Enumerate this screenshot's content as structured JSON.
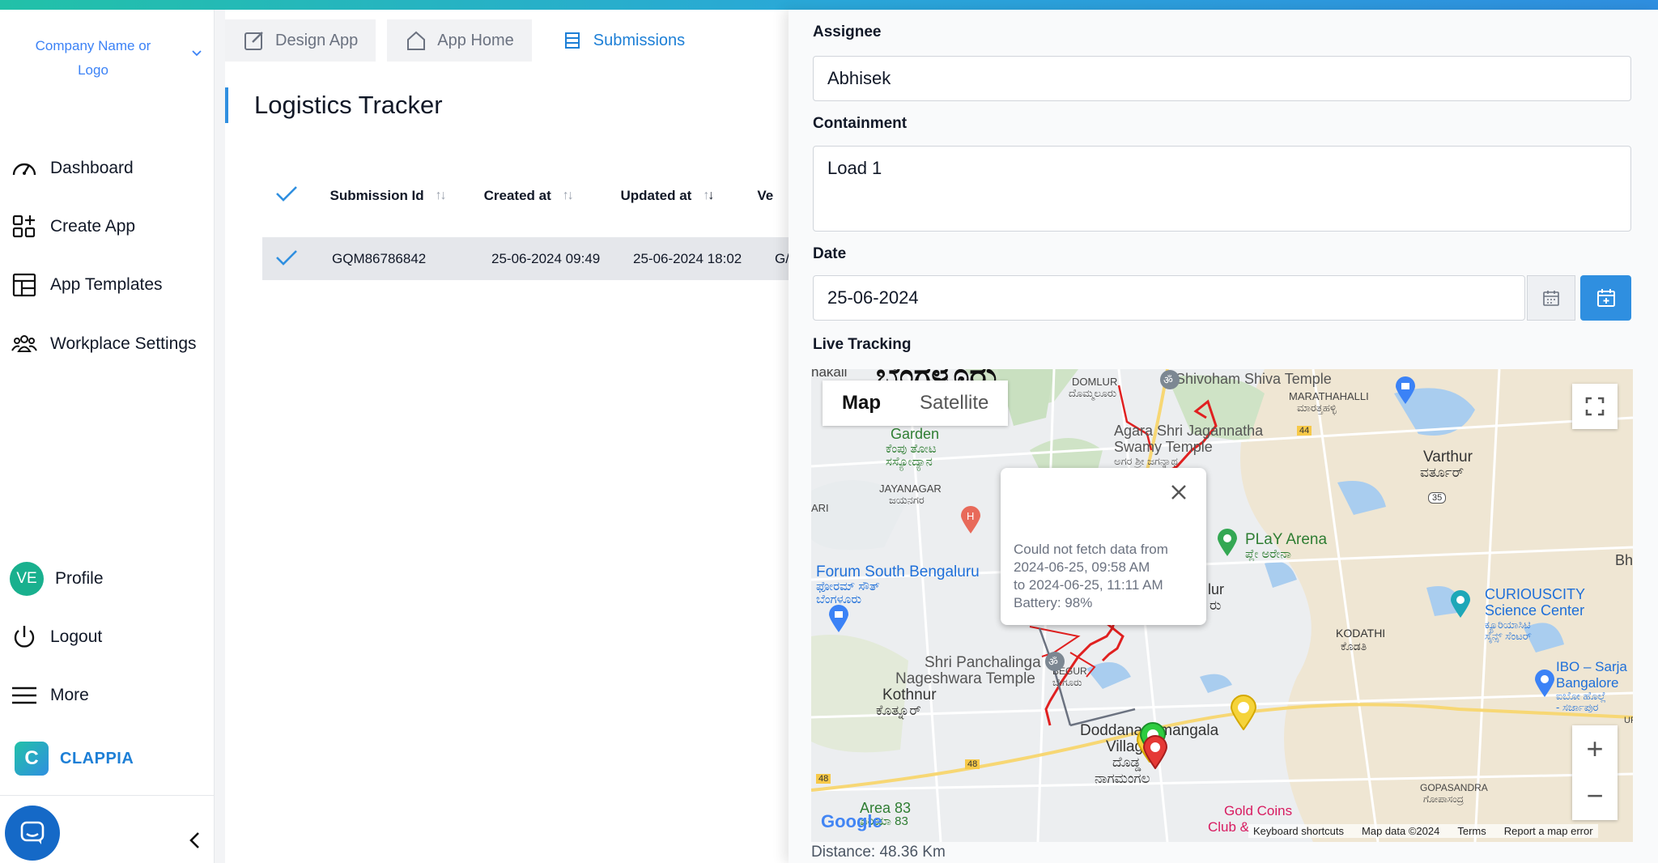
{
  "sidebar": {
    "company": "Company Name or Logo",
    "items": [
      {
        "label": "Dashboard"
      },
      {
        "label": "Create App"
      },
      {
        "label": "App Templates"
      },
      {
        "label": "Workplace Settings"
      }
    ],
    "profile": {
      "initials": "VE",
      "label": "Profile"
    },
    "logout": "Logout",
    "more": "More",
    "brand": "CLAPPIA"
  },
  "tabs": [
    {
      "label": "Design App",
      "active": false
    },
    {
      "label": "App Home",
      "active": false
    },
    {
      "label": "Submissions",
      "active": true
    }
  ],
  "page_title": "Logistics Tracker",
  "table": {
    "columns": [
      "Submission Id",
      "Created at",
      "Updated at",
      "Ve"
    ],
    "rows": [
      {
        "id": "GQM86786842",
        "created": "25-06-2024 09:49",
        "updated": "25-06-2024 18:02",
        "ve": "G/"
      }
    ]
  },
  "panel": {
    "assignee_label": "Assignee",
    "assignee_value": "Abhisek",
    "containment_label": "Containment",
    "containment_value": "Load 1",
    "date_label": "Date",
    "date_value": "25-06-2024",
    "tracking_label": "Live Tracking",
    "distance": "Distance: 48.36 Km"
  },
  "map": {
    "type_map": "Map",
    "type_satellite": "Satellite",
    "popup": {
      "line1": "Could not fetch data from",
      "line2": "2024-06-25, 09:58 AM",
      "line3": "to 2024-06-25, 11:11 AM",
      "line4": "Battery: 98%"
    },
    "footer": {
      "shortcuts": "Keyboard shortcuts",
      "data": "Map data ©2024",
      "terms": "Terms",
      "report": "Report a map error"
    },
    "labels": {
      "domlur": "DOMLUR",
      "domlur_kn": "ದೊಮ್ಮಲೂರು",
      "shivoham": "Shivoham Shiva Temple",
      "marathahalli": "MARATHAHALLI",
      "marathahalli_kn": "ಮಾರತ್ತಹಳ್ಳಿ",
      "garden": "Garden",
      "garden_kn1": "ಕೆಂಪು ತೋಟ",
      "garden_kn2": "ಸಸ್ಯೋದ್ಯಾನ",
      "agara1": "Agara Shri Jagannatha",
      "agara2": "Swamy Temple",
      "agara_kn": "ಅಗರ ಶ್ರೀ ಜಗನ್ನಾಥ",
      "varthur": "Varthur",
      "varthur_kn": "ವರ್ತೂರ್",
      "jayanagar": "JAYANAGAR",
      "jayanagar_kn": "ಜಯನಗರ",
      "play_arena": "PLaY Arena",
      "play_arena_kn": "ಪ್ಲೇ ಅರೇನಾ",
      "forum1": "Forum South Bengaluru",
      "forum_kn1": "ಫೋರಮ್ ಸೌತ್",
      "forum_kn2": "ಬೆಂಗಳೂರು",
      "curiouscity1": "CURIOUSCITY",
      "curiouscity2": "Science Center",
      "curiouscity_kn1": "ಕ್ಯೂರಿಯಾಸಿಟಿ",
      "curiouscity_kn2": "ಸೈನ್ಸ್ ಸೆಂಟರ್",
      "kodathi": "KODATHI",
      "kodathi_kn": "ಕೊಡತಿ",
      "ibo1": "IBO – Sarja",
      "ibo2": "Bangalore",
      "ibo_kn1": "ಐಬೋ ಹೊಲ್ಲೆ",
      "ibo_kn2": "- ಸರ್ಜಾಪುರ",
      "shri1": "Shri Panchalinga",
      "shri2": "Nageshwara Temple",
      "begur": "BEGUR",
      "begur_kn": "ಬೇಗೂರು",
      "kothnur": "Kothnur",
      "kothnur_kn": "ಕೊತ್ನೂರ್",
      "village1": "Doddanagamangala",
      "village2": "Village",
      "village_kn1": "ದೊಡ್ಡ",
      "village_kn2": "ನಾಗಮಂಗಲ",
      "gopasandra": "GOPASANDRA",
      "gopasandra_kn": "ಗೋಪಾಸಂದ್ರ",
      "area83": "Area 83",
      "area83_kn": "ಏರಿಯಾ 83",
      "gold1": "Gold Coins",
      "gold2": "Club &",
      "lur": "lur",
      "lur_kn": "ರು",
      "bh": "Bh",
      "nakali": "nakali",
      "ari": "ARI",
      "ur": "UR",
      "bengaluru_kn": "ಬೆಂಗಳೂರು",
      "road48a": "48",
      "road48b": "48",
      "road35": "35",
      "road44": "44",
      "google": "Google"
    }
  }
}
